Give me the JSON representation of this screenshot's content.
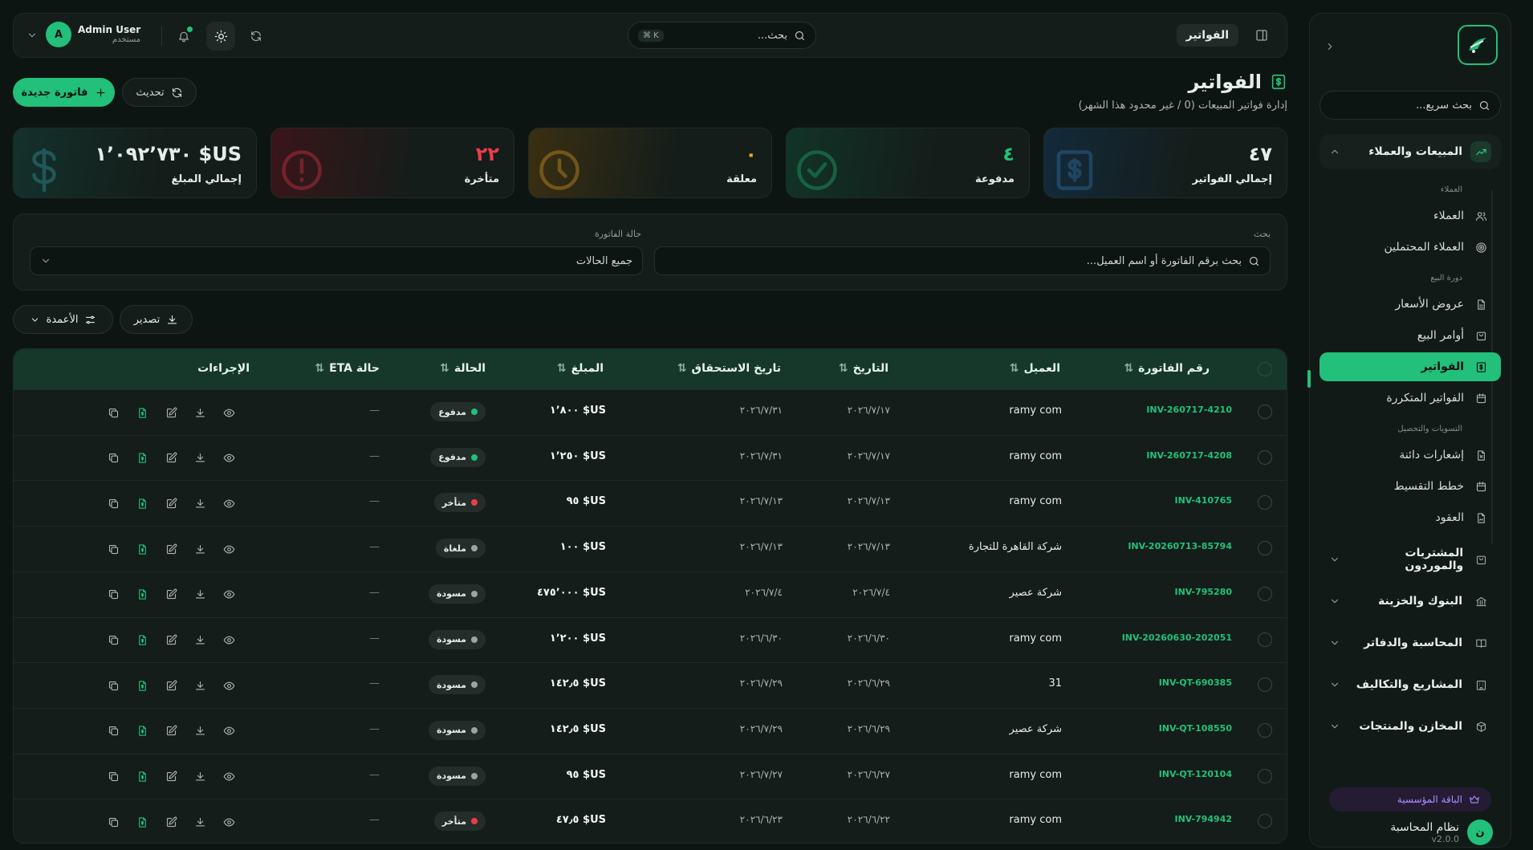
{
  "sidebar": {
    "quick_search_placeholder": "بحث سريع...",
    "sections": {
      "sales": "المبيعات والعملاء",
      "purchases": "المشتريات والموردون",
      "banks": "البنوك والخزينة",
      "accounting": "المحاسبة والدفاتر",
      "projects": "المشاريع والتكاليف",
      "inventory": "المخازن والمنتجات"
    },
    "groups": {
      "clients": "العملاء",
      "sales_cycle": "دورة البيع",
      "settlements": "التسويات والتحصيل"
    },
    "items": {
      "clients": "العملاء",
      "leads": "العملاء المحتملين",
      "quotes": "عروض الأسعار",
      "orders": "أوامر البيع",
      "invoices": "الفواتير",
      "recurring": "الفواتير المتكررة",
      "credit_notes": "إشعارات دائنة",
      "installments": "خطط التقسيط",
      "contracts": "العقود"
    },
    "plan": "الباقة المؤسسية",
    "system_name": "نظام المحاسبة",
    "version": "v2.0.0",
    "avatar_letter": "ن"
  },
  "header": {
    "title": "الفواتير",
    "search_placeholder": "بحث...",
    "shortcut": "⌘ K",
    "user_name": "Admin User",
    "user_role": "مستخدم",
    "avatar_letter": "A"
  },
  "page": {
    "title": "الفواتير",
    "subtitle": "إدارة فواتير المبيعات (0 / غير محدود هذا الشهر)",
    "new_button": "فاتورة جديدة",
    "refresh_button": "تحديث"
  },
  "stats": {
    "total_invoices": {
      "value": "٤٧",
      "label": "إجمالي الفواتير"
    },
    "paid": {
      "value": "٤",
      "label": "مدفوعة"
    },
    "pending": {
      "value": "٠",
      "label": "معلقة"
    },
    "overdue": {
      "value": "٢٢",
      "label": "متأخرة"
    },
    "total_amount": {
      "value": "US$ ١٬٠٩٢٬٧٣٠",
      "label": "إجمالي المبلغ"
    }
  },
  "filters": {
    "search_label": "بحث",
    "search_placeholder": "بحث برقم الفاتورة أو اسم العميل...",
    "status_label": "حالة الفاتورة",
    "status_value": "جميع الحالات"
  },
  "toolbar": {
    "export": "تصدير",
    "columns": "الأعمدة"
  },
  "table": {
    "columns": {
      "invoice_no": "رقم الفاتورة",
      "client": "العميل",
      "date": "التاريخ",
      "due_date": "تاريخ الاستحقاق",
      "amount": "المبلغ",
      "status": "الحالة",
      "eta": "حالة ETA",
      "actions": "الإجراءات"
    },
    "rows": [
      {
        "inv": "INV-260717-4210",
        "client": "ramy com",
        "date": "٢٠٢٦/٧/١٧",
        "due": "٢٠٢٦/٧/٣١",
        "amount": "US$ ١٬٨٠٠",
        "status": "مدفوع",
        "status_color": "#22c07a",
        "eta": "—"
      },
      {
        "inv": "INV-260717-4208",
        "client": "ramy com",
        "date": "٢٠٢٦/٧/١٧",
        "due": "٢٠٢٦/٧/٣١",
        "amount": "US$ ١٬٢٥٠",
        "status": "مدفوع",
        "status_color": "#22c07a",
        "eta": "—"
      },
      {
        "inv": "INV-410765",
        "client": "ramy com",
        "date": "٢٠٢٦/٧/١٣",
        "due": "٢٠٢٦/٧/١٣",
        "amount": "US$ ٩٥",
        "status": "متأخر",
        "status_color": "#ef3b4a",
        "eta": "—"
      },
      {
        "inv": "INV-20260713-85794",
        "client": "شركة القاهرة للتجارة",
        "date": "٢٠٢٦/٧/١٣",
        "due": "٢٠٢٦/٧/١٣",
        "amount": "US$ ١٠٠",
        "status": "ملغاة",
        "status_color": "#9aa5a1",
        "eta": "—"
      },
      {
        "inv": "INV-795280",
        "client": "شركة عصير",
        "date": "٢٠٢٦/٧/٤",
        "due": "٢٠٢٦/٧/٤",
        "amount": "US$ ٤٧٥٬٠٠٠",
        "status": "مسودة",
        "status_color": "#9aa5a1",
        "eta": "—"
      },
      {
        "inv": "INV-20260630-202051",
        "client": "ramy com",
        "date": "٢٠٢٦/٦/٣٠",
        "due": "٢٠٢٦/٦/٣٠",
        "amount": "US$ ١٬٢٠٠",
        "status": "مسودة",
        "status_color": "#9aa5a1",
        "eta": "—"
      },
      {
        "inv": "INV-QT-690385",
        "client": "31",
        "date": "٢٠٢٦/٦/٢٩",
        "due": "٢٠٢٦/٧/٢٩",
        "amount": "US$ ١٤٢٫٥",
        "status": "مسودة",
        "status_color": "#9aa5a1",
        "eta": "—"
      },
      {
        "inv": "INV-QT-108550",
        "client": "شركة عصير",
        "date": "٢٠٢٦/٦/٢٩",
        "due": "٢٠٢٦/٧/٢٩",
        "amount": "US$ ١٤٢٫٥",
        "status": "مسودة",
        "status_color": "#9aa5a1",
        "eta": "—"
      },
      {
        "inv": "INV-QT-120104",
        "client": "ramy com",
        "date": "٢٠٢٦/٦/٢٧",
        "due": "٢٠٢٦/٧/٢٧",
        "amount": "US$ ٩٥",
        "status": "مسودة",
        "status_color": "#9aa5a1",
        "eta": "—"
      },
      {
        "inv": "INV-794942",
        "client": "ramy com",
        "date": "٢٠٢٦/٦/٢٢",
        "due": "٢٠٢٦/٦/٢٣",
        "amount": "US$ ٤٧٫٥",
        "status": "متأخر",
        "status_color": "#ef3b4a",
        "eta": "—"
      }
    ]
  },
  "colors": {
    "accent": "#22c07a",
    "danger": "#ef3b4a",
    "warning": "#f0a623",
    "background": "#0d1512"
  }
}
